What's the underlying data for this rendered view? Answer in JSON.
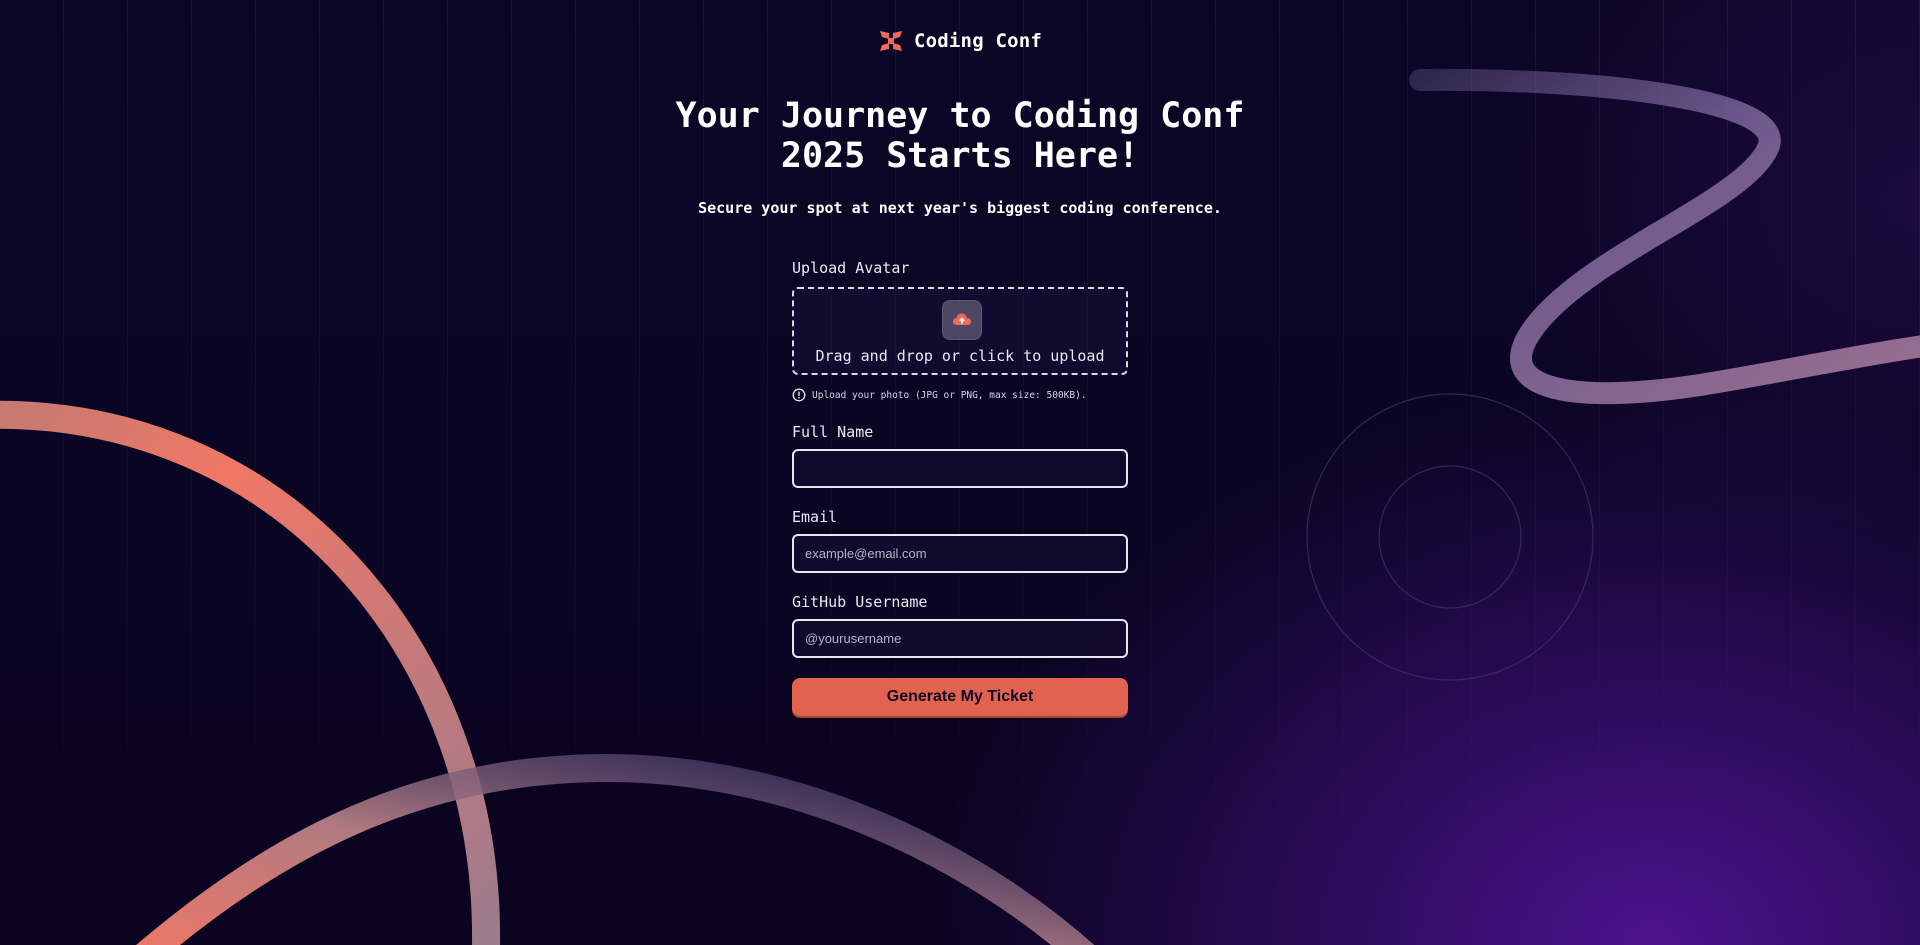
{
  "colors": {
    "accent": "#e0624f",
    "background": "#0a0524",
    "upload_icon_bg": "#4c4864"
  },
  "brand": {
    "name": "Coding Conf",
    "icon": "coding-conf-logo-icon"
  },
  "hero": {
    "title_line1": "Your Journey to Coding Conf",
    "title_line2": "2025 Starts Here!",
    "subtitle": "Secure your spot at next year's biggest coding conference."
  },
  "form": {
    "avatar": {
      "label": "Upload Avatar",
      "dropzone_text": "Drag and drop or click to upload",
      "icon": "cloud-upload-icon",
      "hint": "Upload your photo (JPG or PNG, max size: 500KB)."
    },
    "full_name": {
      "label": "Full Name",
      "value": "",
      "placeholder": ""
    },
    "email": {
      "label": "Email",
      "value": "",
      "placeholder": "example@email.com"
    },
    "github": {
      "label": "GitHub Username",
      "value": "",
      "placeholder": "@yourusername"
    },
    "submit_label": "Generate My Ticket"
  }
}
